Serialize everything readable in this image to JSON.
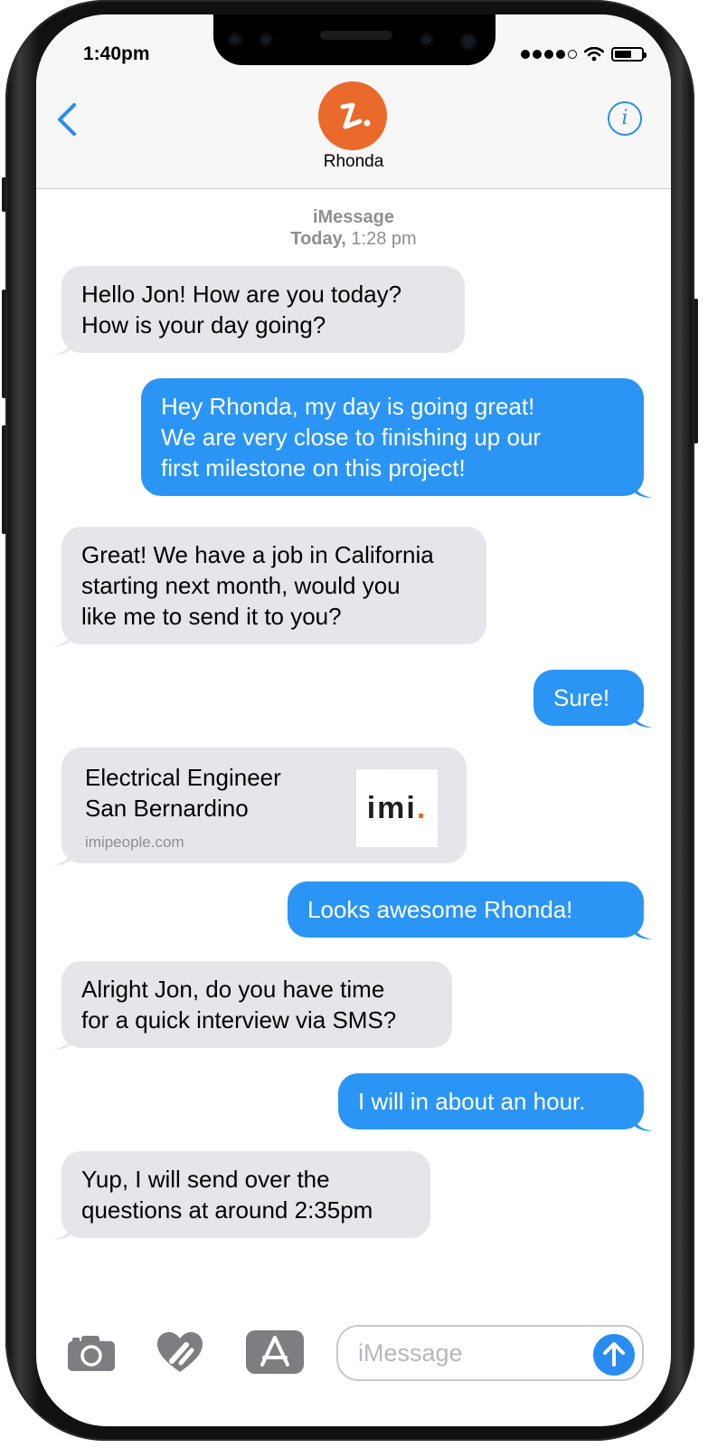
{
  "status_bar": {
    "time": "1:40pm"
  },
  "header": {
    "contact_name": "Rhonda"
  },
  "conversation": {
    "service": "iMessage",
    "date_label": "Today,",
    "time_label": "1:28 pm",
    "messages": [
      {
        "direction": "incoming",
        "lines": [
          "Hello Jon! How are you today?",
          "How is your day going?"
        ]
      },
      {
        "direction": "outgoing",
        "lines": [
          "Hey Rhonda, my day is going great!",
          "We are very close to finishing up our",
          "first milestone on this project!"
        ]
      },
      {
        "direction": "incoming",
        "lines": [
          "Great! We have a job in California",
          "starting next month, would you",
          "like me to send it to you?"
        ]
      },
      {
        "direction": "outgoing",
        "lines": [
          "Sure!"
        ]
      },
      {
        "direction": "incoming",
        "type": "link_preview",
        "title_lines": [
          "Electrical Engineer",
          "San Bernardino"
        ],
        "domain": "imipeople.com",
        "thumbnail_text": "imi",
        "thumbnail_dot": "."
      },
      {
        "direction": "outgoing",
        "lines": [
          "Looks awesome Rhonda!"
        ]
      },
      {
        "direction": "incoming",
        "lines": [
          "Alright Jon, do you have time",
          "for a quick interview via SMS?"
        ]
      },
      {
        "direction": "outgoing",
        "lines": [
          "I will in about an hour."
        ]
      },
      {
        "direction": "incoming",
        "lines": [
          "Yup, I will send over the",
          "questions at around 2:35pm"
        ]
      }
    ]
  },
  "composer": {
    "placeholder": "iMessage",
    "icons": [
      "camera-icon",
      "digital-touch-icon",
      "app-store-icon",
      "send-icon"
    ]
  },
  "colors": {
    "incoming_bubble": "#e5e5ea",
    "outgoing_bubble": "#2a95f5",
    "accent": "#2a8cf1",
    "avatar": "#ea6a2b"
  }
}
